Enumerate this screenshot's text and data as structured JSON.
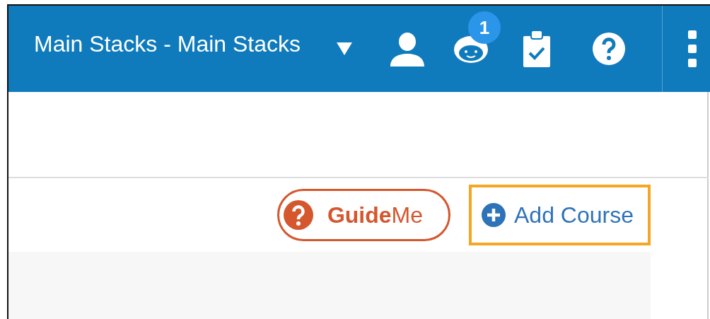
{
  "header": {
    "title": "Main Stacks - Main Stacks",
    "notification_count": "1"
  },
  "guide_button": {
    "label": "**Guide**Me"
  },
  "add_course_button": {
    "label": "Add Course",
    "highlighted": true
  }
}
